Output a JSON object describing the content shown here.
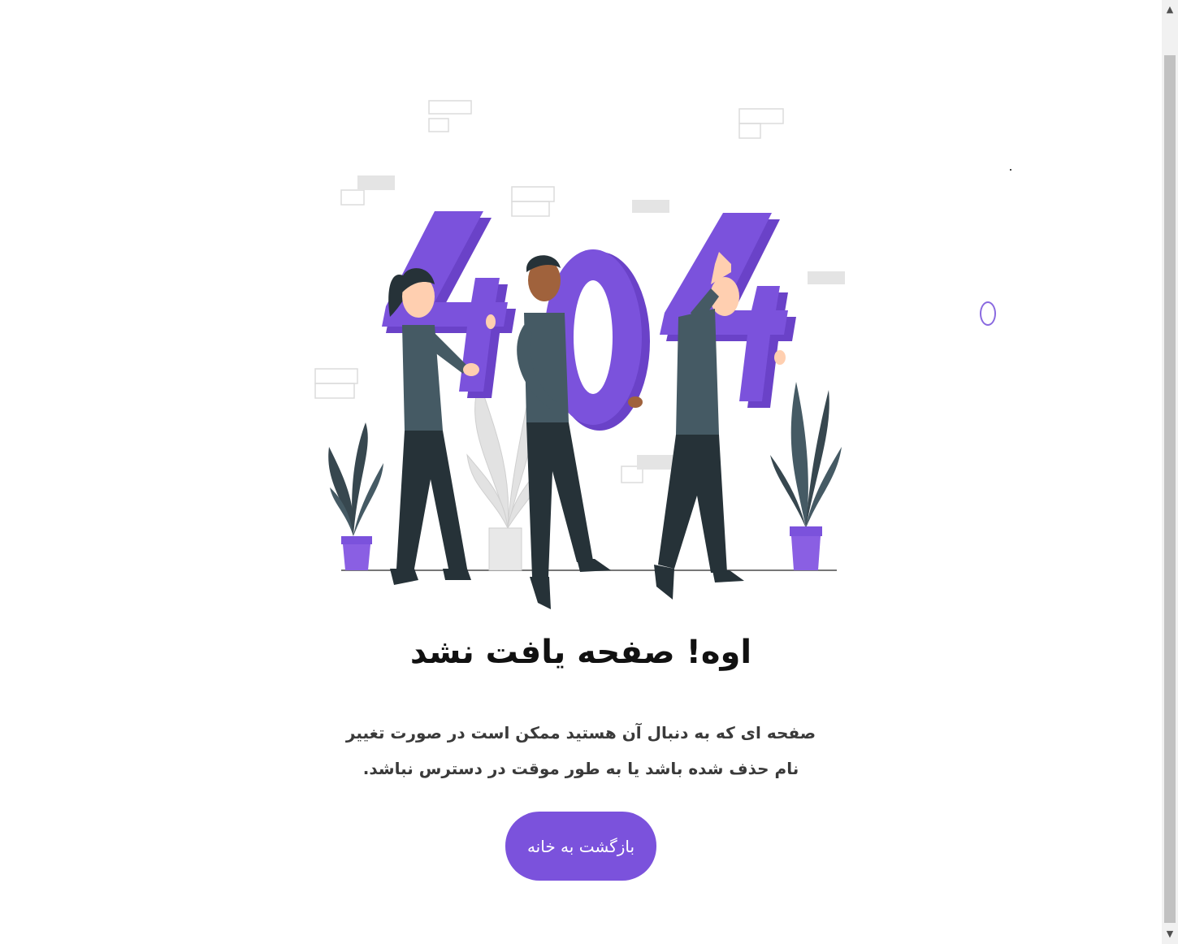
{
  "error_page": {
    "illustration_text": "404",
    "heading": "اوه! صفحه یافت نشد",
    "description": "صفحه ای که به دنبال آن هستید ممکن است در صورت تغییر نام حذف شده باشد یا به طور موقت در دسترس نباشد.",
    "home_button_label": "بازگشت به خانه"
  },
  "scrollbar": {
    "up_arrow": "▲",
    "down_arrow": "▼"
  },
  "colors": {
    "accent": "#7b52dc",
    "figure_dark": "#263238",
    "figure_shirt": "#455a64"
  }
}
